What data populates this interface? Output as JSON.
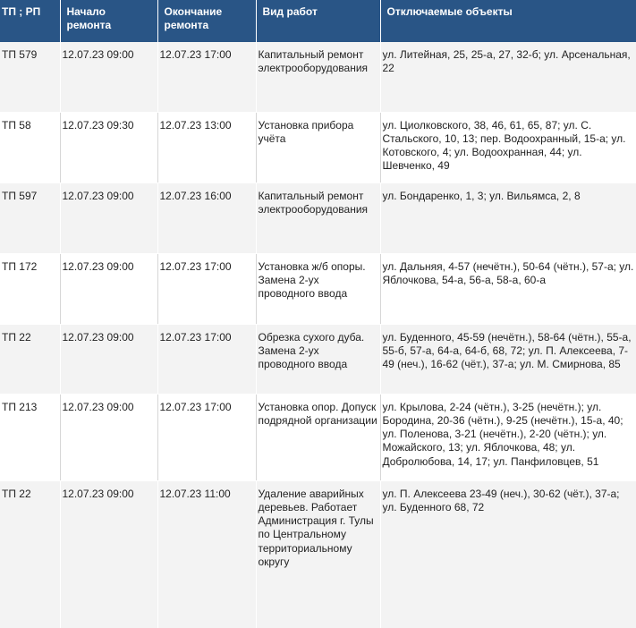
{
  "table": {
    "headers": [
      "ТП ; РП",
      "Начало ремонта",
      "Окончание ремонта",
      "Вид работ",
      "Отключаемые объекты"
    ],
    "rows": [
      {
        "tp": "ТП 579",
        "start": "12.07.23 09:00",
        "end": "12.07.23 17:00",
        "work": "Капитальный ремонт электрооборудования",
        "objects": "ул. Литейная, 25, 25-а, 27, 32-б; ул. Арсенальная, 22"
      },
      {
        "tp": "ТП 58",
        "start": "12.07.23 09:30",
        "end": "12.07.23 13:00",
        "work": "Установка прибора учёта",
        "objects": "ул. Циолковского, 38, 46, 61, 65, 87; ул. С. Стальского, 10, 13; пер. Водоохранный, 15-а; ул. Котовского, 4; ул. Водоохранная, 44; ул. Шевченко, 49"
      },
      {
        "tp": "ТП 597",
        "start": "12.07.23 09:00",
        "end": "12.07.23 16:00",
        "work": "Капитальный ремонт электрооборудования",
        "objects": "ул. Бондаренко, 1, 3; ул. Вильямса, 2, 8"
      },
      {
        "tp": "ТП 172",
        "start": "12.07.23 09:00",
        "end": "12.07.23 17:00",
        "work": "Установка ж/б опоры. Замена 2-ух проводного ввода",
        "objects": "ул. Дальняя, 4-57 (нечётн.), 50-64 (чётн.), 57-а; ул. Яблочкова, 54-а, 56-а, 58-а, 60-а"
      },
      {
        "tp": "ТП 22",
        "start": "12.07.23 09:00",
        "end": "12.07.23 17:00",
        "work": "Обрезка сухого дуба. Замена 2-ух проводного ввода",
        "objects": "ул. Буденного, 45-59 (нечётн.), 58-64 (чётн.), 55-а, 55-б, 57-а, 64-а, 64-б, 68, 72; ул. П. Алексеева, 7-49 (неч.), 16-62 (чёт.), 37-а; ул. М. Смирнова, 85"
      },
      {
        "tp": "ТП 213",
        "start": "12.07.23 09:00",
        "end": "12.07.23 17:00",
        "work": "Установка опор. Допуск подрядной организации",
        "objects": "ул. Крылова, 2-24 (чётн.), 3-25 (нечётн.); ул. Бородина, 20-36 (чётн.), 9-25 (нечётн.), 15-а, 40; ул. Поленова, 3-21 (нечётн.), 2-20 (чётн.); ул. Можайского, 13; ул. Яблочкова, 48; ул. Добролюбова, 14, 17; ул. Панфиловцев, 51"
      },
      {
        "tp": "ТП 22",
        "start": "12.07.23 09:00",
        "end": "12.07.23 11:00",
        "work": "Удаление аварийных деревьев. Работает Администрация г. Тулы по Центральному территориальному округу",
        "objects": "ул. П. Алексеева 23-49 (неч.), 30-62 (чёт.), 37-а; ул. Буденного 68, 72"
      }
    ]
  }
}
